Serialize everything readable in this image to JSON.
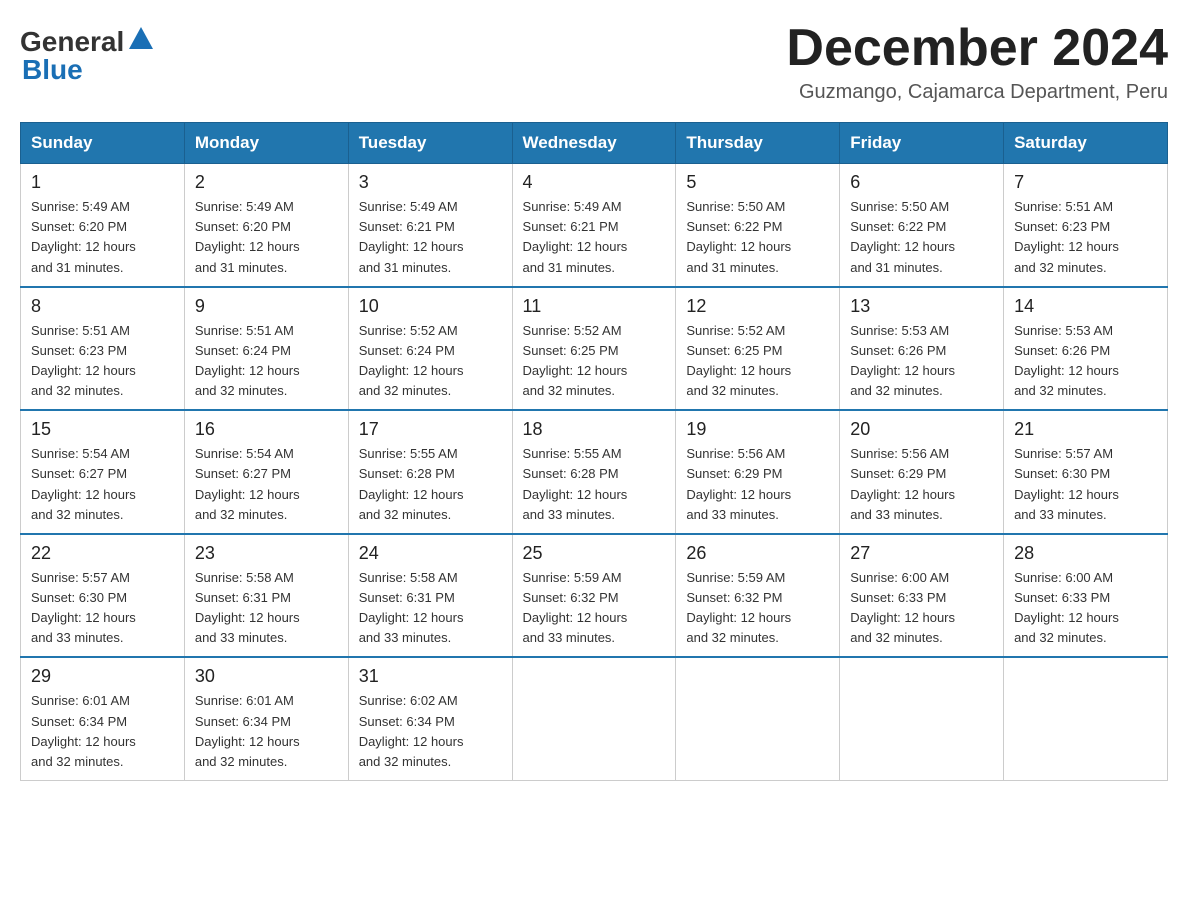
{
  "logo": {
    "text_general": "General",
    "text_blue": "Blue",
    "arrow": "▲"
  },
  "title": "December 2024",
  "subtitle": "Guzmango, Cajamarca Department, Peru",
  "weekdays": [
    "Sunday",
    "Monday",
    "Tuesday",
    "Wednesday",
    "Thursday",
    "Friday",
    "Saturday"
  ],
  "weeks": [
    [
      {
        "day": "1",
        "sunrise": "5:49 AM",
        "sunset": "6:20 PM",
        "daylight": "12 hours and 31 minutes."
      },
      {
        "day": "2",
        "sunrise": "5:49 AM",
        "sunset": "6:20 PM",
        "daylight": "12 hours and 31 minutes."
      },
      {
        "day": "3",
        "sunrise": "5:49 AM",
        "sunset": "6:21 PM",
        "daylight": "12 hours and 31 minutes."
      },
      {
        "day": "4",
        "sunrise": "5:49 AM",
        "sunset": "6:21 PM",
        "daylight": "12 hours and 31 minutes."
      },
      {
        "day": "5",
        "sunrise": "5:50 AM",
        "sunset": "6:22 PM",
        "daylight": "12 hours and 31 minutes."
      },
      {
        "day": "6",
        "sunrise": "5:50 AM",
        "sunset": "6:22 PM",
        "daylight": "12 hours and 31 minutes."
      },
      {
        "day": "7",
        "sunrise": "5:51 AM",
        "sunset": "6:23 PM",
        "daylight": "12 hours and 32 minutes."
      }
    ],
    [
      {
        "day": "8",
        "sunrise": "5:51 AM",
        "sunset": "6:23 PM",
        "daylight": "12 hours and 32 minutes."
      },
      {
        "day": "9",
        "sunrise": "5:51 AM",
        "sunset": "6:24 PM",
        "daylight": "12 hours and 32 minutes."
      },
      {
        "day": "10",
        "sunrise": "5:52 AM",
        "sunset": "6:24 PM",
        "daylight": "12 hours and 32 minutes."
      },
      {
        "day": "11",
        "sunrise": "5:52 AM",
        "sunset": "6:25 PM",
        "daylight": "12 hours and 32 minutes."
      },
      {
        "day": "12",
        "sunrise": "5:52 AM",
        "sunset": "6:25 PM",
        "daylight": "12 hours and 32 minutes."
      },
      {
        "day": "13",
        "sunrise": "5:53 AM",
        "sunset": "6:26 PM",
        "daylight": "12 hours and 32 minutes."
      },
      {
        "day": "14",
        "sunrise": "5:53 AM",
        "sunset": "6:26 PM",
        "daylight": "12 hours and 32 minutes."
      }
    ],
    [
      {
        "day": "15",
        "sunrise": "5:54 AM",
        "sunset": "6:27 PM",
        "daylight": "12 hours and 32 minutes."
      },
      {
        "day": "16",
        "sunrise": "5:54 AM",
        "sunset": "6:27 PM",
        "daylight": "12 hours and 32 minutes."
      },
      {
        "day": "17",
        "sunrise": "5:55 AM",
        "sunset": "6:28 PM",
        "daylight": "12 hours and 32 minutes."
      },
      {
        "day": "18",
        "sunrise": "5:55 AM",
        "sunset": "6:28 PM",
        "daylight": "12 hours and 33 minutes."
      },
      {
        "day": "19",
        "sunrise": "5:56 AM",
        "sunset": "6:29 PM",
        "daylight": "12 hours and 33 minutes."
      },
      {
        "day": "20",
        "sunrise": "5:56 AM",
        "sunset": "6:29 PM",
        "daylight": "12 hours and 33 minutes."
      },
      {
        "day": "21",
        "sunrise": "5:57 AM",
        "sunset": "6:30 PM",
        "daylight": "12 hours and 33 minutes."
      }
    ],
    [
      {
        "day": "22",
        "sunrise": "5:57 AM",
        "sunset": "6:30 PM",
        "daylight": "12 hours and 33 minutes."
      },
      {
        "day": "23",
        "sunrise": "5:58 AM",
        "sunset": "6:31 PM",
        "daylight": "12 hours and 33 minutes."
      },
      {
        "day": "24",
        "sunrise": "5:58 AM",
        "sunset": "6:31 PM",
        "daylight": "12 hours and 33 minutes."
      },
      {
        "day": "25",
        "sunrise": "5:59 AM",
        "sunset": "6:32 PM",
        "daylight": "12 hours and 33 minutes."
      },
      {
        "day": "26",
        "sunrise": "5:59 AM",
        "sunset": "6:32 PM",
        "daylight": "12 hours and 32 minutes."
      },
      {
        "day": "27",
        "sunrise": "6:00 AM",
        "sunset": "6:33 PM",
        "daylight": "12 hours and 32 minutes."
      },
      {
        "day": "28",
        "sunrise": "6:00 AM",
        "sunset": "6:33 PM",
        "daylight": "12 hours and 32 minutes."
      }
    ],
    [
      {
        "day": "29",
        "sunrise": "6:01 AM",
        "sunset": "6:34 PM",
        "daylight": "12 hours and 32 minutes."
      },
      {
        "day": "30",
        "sunrise": "6:01 AM",
        "sunset": "6:34 PM",
        "daylight": "12 hours and 32 minutes."
      },
      {
        "day": "31",
        "sunrise": "6:02 AM",
        "sunset": "6:34 PM",
        "daylight": "12 hours and 32 minutes."
      },
      null,
      null,
      null,
      null
    ]
  ],
  "labels": {
    "sunrise": "Sunrise:",
    "sunset": "Sunset:",
    "daylight": "Daylight:"
  }
}
